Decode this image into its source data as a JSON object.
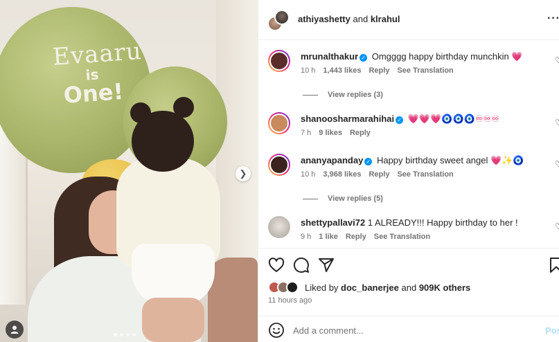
{
  "photo": {
    "balloon_text": {
      "line1": "Evaaru",
      "line2": "is",
      "line3": "One!"
    },
    "carousel": {
      "slides": 4,
      "active": 1
    }
  },
  "header": {
    "user1": "athiyashetty",
    "connector": "and",
    "user2": "klrahul",
    "more_icon": "more-horizontal-icon"
  },
  "comments": [
    {
      "username": "mrunalthakur",
      "verified": true,
      "text": "Omgggg happy birthday munchkin",
      "emoji": "💗",
      "time": "10 h",
      "likes": "1,443 likes",
      "reply": "Reply",
      "translate": "See Translation",
      "replies": "View replies (3)",
      "avatar_color": "#5a2d2a"
    },
    {
      "username": "shanoosharmarahihai",
      "verified": true,
      "text": "",
      "emoji": "💗💗💗🧿🧿🧿♾♾♾",
      "time": "7 h",
      "likes": "9 likes",
      "reply": "Reply",
      "translate": "",
      "replies": "",
      "avatar_color": "#c98a5e"
    },
    {
      "username": "ananyapanday",
      "verified": true,
      "text": "Happy birthday sweet angel",
      "emoji": "💗✨🧿",
      "time": "10 h",
      "likes": "3,968 likes",
      "reply": "Reply",
      "translate": "See Translation",
      "replies": "View replies (5)",
      "avatar_color": "#3b2320"
    },
    {
      "username": "shettypallavi72",
      "verified": false,
      "text": "1 ALREADY!!! Happy birthday to her !",
      "emoji": "",
      "time": "9 h",
      "likes": "1 like",
      "reply": "Reply",
      "translate": "See Translation",
      "replies": "",
      "avatar_color": "#d8d4cf"
    }
  ],
  "actions": {
    "like_icon": "heart-icon",
    "comment_icon": "comment-icon",
    "share_icon": "share-icon",
    "save_icon": "bookmark-icon"
  },
  "likes": {
    "prefix": "Liked by",
    "user": "doc_banerjee",
    "connector": "and",
    "others": "909K others"
  },
  "timestamp": "11 hours ago",
  "add_comment": {
    "placeholder": "Add a comment...",
    "post_label": "Post"
  },
  "colors": {
    "accent": "#0095f6",
    "heart": "#e41e5b",
    "muted": "#737373"
  }
}
